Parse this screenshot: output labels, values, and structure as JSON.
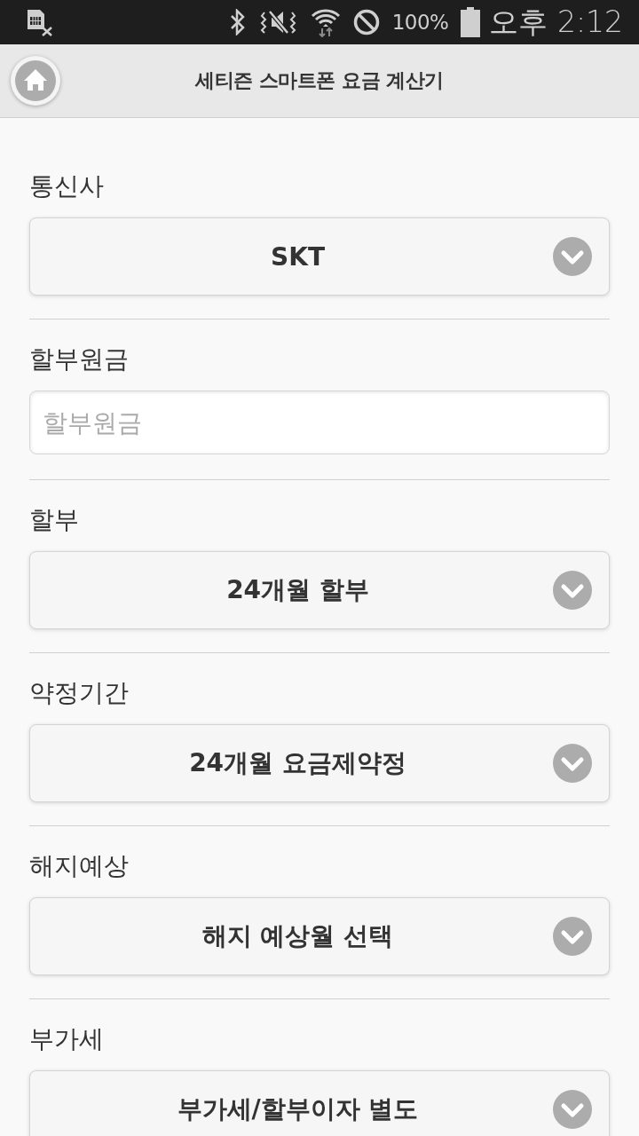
{
  "status_bar": {
    "battery": "100%",
    "time": "오후 2:12"
  },
  "header": {
    "title": "세티즌 스마트폰 요금 계산기"
  },
  "form": {
    "fields": [
      {
        "kind": "select",
        "label": "통신사",
        "value": "SKT"
      },
      {
        "kind": "input",
        "label": "할부원금",
        "placeholder": "할부원금"
      },
      {
        "kind": "select",
        "label": "할부",
        "value": "24개월 할부"
      },
      {
        "kind": "select",
        "label": "약정기간",
        "value": "24개월 요금제약정"
      },
      {
        "kind": "select",
        "label": "해지예상",
        "value": "해지 예상월 선택"
      },
      {
        "kind": "select",
        "label": "부가세",
        "value": "부가세/할부이자 별도"
      }
    ]
  }
}
